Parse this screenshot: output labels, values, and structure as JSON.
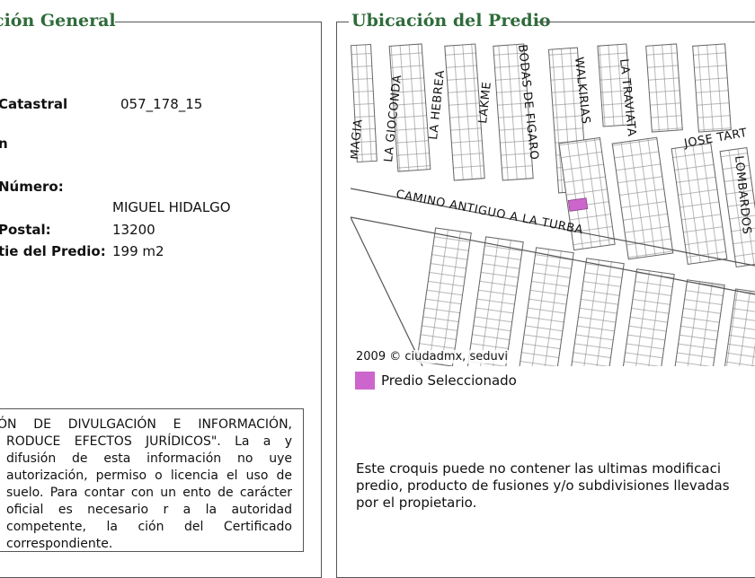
{
  "left_panel": {
    "legend": "ción General",
    "fields": [
      {
        "label": "Catastral",
        "value": "057_178_15"
      },
      {
        "label": "n",
        "value": ""
      },
      {
        "label": "Número:",
        "value": ""
      },
      {
        "label": "",
        "value": "MIGUEL HIDALGO"
      },
      {
        "label": "Postal:",
        "value": "13200"
      },
      {
        "label": "tie del Predio:",
        "value": "199 m2"
      }
    ],
    "notice": "ÓN DE DIVULGACIÓN E INFORMACIÓN, RODUCE EFECTOS JURÍDICOS\". La a y difusión de esta información no uye autorización, permiso o licencia el uso de suelo. Para contar con un ento de carácter oficial es necesario r a la autoridad competente, la ción del Certificado correspondiente."
  },
  "right_panel": {
    "legend": "Ubicación del Predio",
    "streets": [
      "LA GIOCONDA",
      "LA HEBREA",
      "LAKME",
      "BODAS DE FIGARO",
      "WALKIRIAS",
      "LA TRAVIATA",
      "JOSE TART",
      "LOMBARDOS",
      "CAMINO ANTIGUO A LA TURBA",
      "MAGIA"
    ],
    "attribution": "2009 © ciudadmx, seduvi",
    "map_legend_label": "Predio Seleccionado",
    "colors": {
      "selected_parcel": "#cc66cc",
      "legend_text": "#2f6b3a"
    },
    "disclaimer": "Este croquis puede no contener las ultimas modificaci\npredio, producto de fusiones y/o subdivisiones llevadas\npor el propietario."
  }
}
